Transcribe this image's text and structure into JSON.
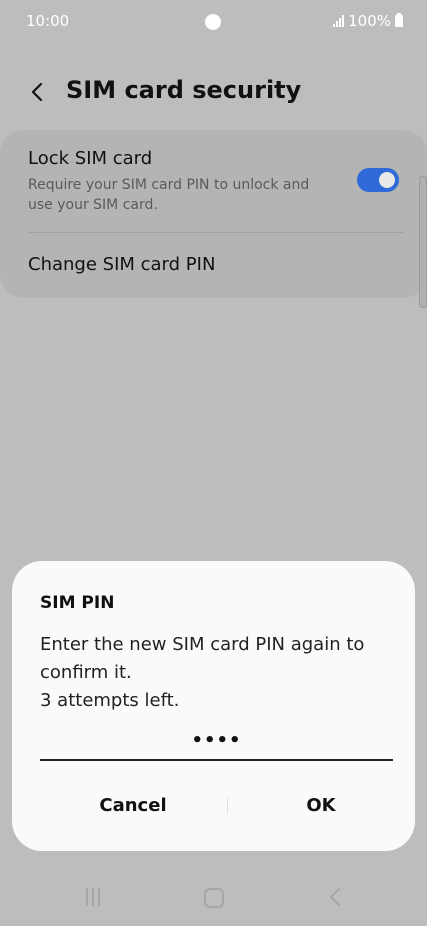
{
  "status_bar": {
    "time": "10:00",
    "battery": "100%",
    "icons": [
      "camera-dot",
      "signal-icon",
      "battery-icon"
    ]
  },
  "header": {
    "title": "SIM card security",
    "back_icon": "chevron-left-icon"
  },
  "settings": {
    "lock": {
      "title": "Lock SIM card",
      "description": "Require your SIM card PIN to unlock and use your SIM card.",
      "enabled": true
    },
    "change_pin": {
      "title": "Change SIM card PIN"
    }
  },
  "dialog": {
    "title": "SIM PIN",
    "message_line1": "Enter the new SIM card PIN again to confirm it.",
    "message_line2": "3 attempts left.",
    "pin_value": "••••",
    "cancel_label": "Cancel",
    "ok_label": "OK"
  },
  "nav_bar": {
    "icons": [
      "recents-icon",
      "home-icon",
      "back-icon"
    ]
  },
  "colors": {
    "toggle_on": "#2f6bd8",
    "dim_background": "#bdbdbd",
    "dialog_background": "#fafafc"
  }
}
